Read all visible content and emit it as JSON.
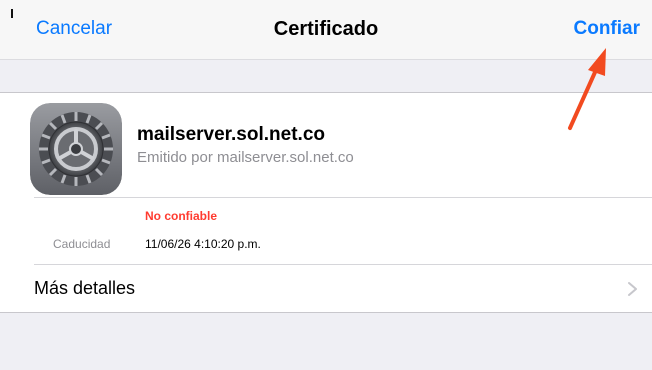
{
  "nav": {
    "cancel_label": "Cancelar",
    "title": "Certificado",
    "trust_label": "Confiar"
  },
  "certificate": {
    "name": "mailserver.sol.net.co",
    "issuer": "Emitido por mailserver.sol.net.co",
    "trust_status": "No confiable",
    "expiration_label": "Caducidad",
    "expiration_value": "11/06/26 4:10:20 p.m.",
    "icon": "settings-gear-icon"
  },
  "details": {
    "label": "Más detalles",
    "icon": "chevron-right-icon"
  },
  "colors": {
    "accent": "#0a7aff",
    "warning": "#ff3b30",
    "annotation_arrow": "#f24a20"
  }
}
